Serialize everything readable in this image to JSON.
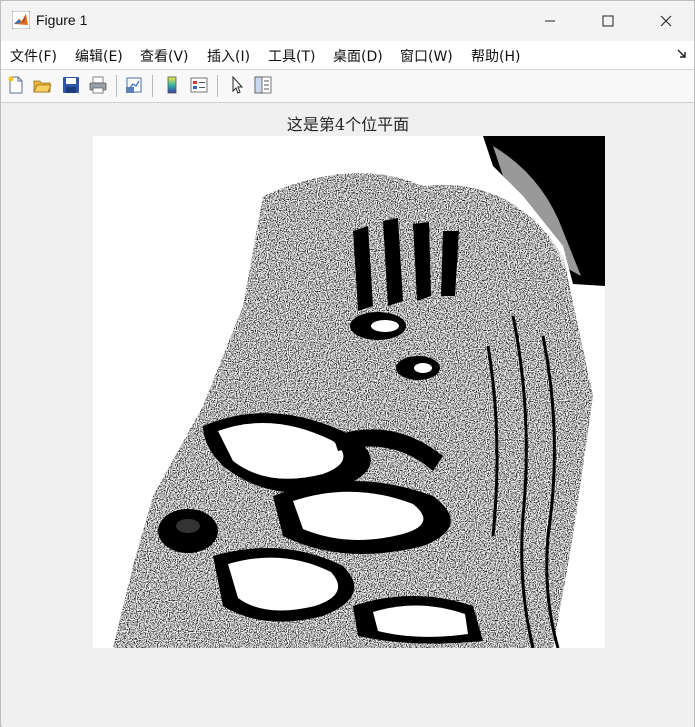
{
  "window": {
    "title": "Figure 1"
  },
  "menu": [
    {
      "label": "文件(F)"
    },
    {
      "label": "编辑(E)"
    },
    {
      "label": "查看(V)"
    },
    {
      "label": "插入(I)"
    },
    {
      "label": "工具(T)"
    },
    {
      "label": "桌面(D)"
    },
    {
      "label": "窗口(W)"
    },
    {
      "label": "帮助(H)"
    }
  ],
  "toolbar": {
    "icons": [
      "new-figure-icon",
      "open-file-icon",
      "save-icon",
      "print-icon",
      "link-plot-icon",
      "insert-colorbar-icon",
      "insert-legend-icon",
      "edit-plot-icon",
      "open-property-inspector-icon"
    ]
  },
  "figure": {
    "axes_title": "这是第4个位平面",
    "image_description_colors": {
      "foreground": "#000000",
      "background": "#ffffff"
    }
  }
}
